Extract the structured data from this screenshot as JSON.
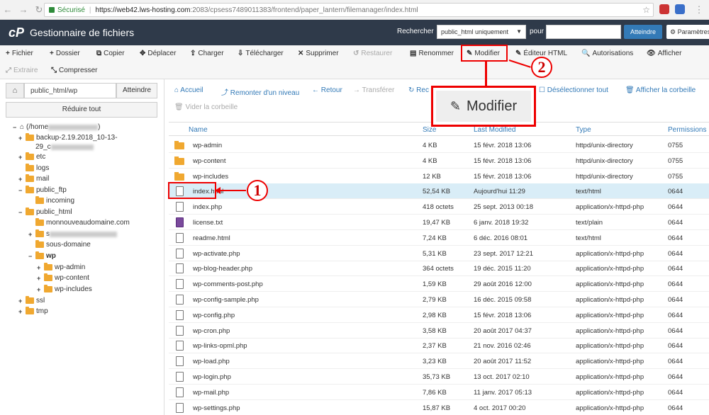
{
  "browser": {
    "secure_label": "Sécurisé",
    "url_host": "https://web42.lws-hosting.com",
    "url_path": ":2083/cpsess7489011383/frontend/paper_lantern/filemanager/index.html"
  },
  "header": {
    "logo": "cP",
    "title": "Gestionnaire de fichiers",
    "search_label": "Rechercher",
    "search_scope": "public_html uniquement",
    "pour_label": "pour",
    "go_label": "Atteindre",
    "settings_label": "Paramètres"
  },
  "toolbar": {
    "row1": [
      {
        "icon": "+",
        "label": "Fichier",
        "name": "new-file"
      },
      {
        "icon": "+",
        "label": "Dossier",
        "name": "new-folder"
      },
      {
        "icon": "⧉",
        "label": "Copier",
        "name": "copy"
      },
      {
        "icon": "✥",
        "label": "Déplacer",
        "name": "move"
      },
      {
        "icon": "⇪",
        "label": "Charger",
        "name": "upload"
      },
      {
        "icon": "⇩",
        "label": "Télécharger",
        "name": "download"
      },
      {
        "icon": "✕",
        "label": "Supprimer",
        "name": "delete"
      },
      {
        "icon": "↺",
        "label": "Restaurer",
        "name": "restore"
      },
      {
        "icon": "▤",
        "label": "Renommer",
        "name": "rename"
      },
      {
        "icon": "✎",
        "label": "Modifier",
        "name": "edit"
      },
      {
        "icon": "✎",
        "label": "Éditeur HTML",
        "name": "html-editor"
      },
      {
        "icon": "🔍",
        "label": "Autorisations",
        "name": "permissions"
      },
      {
        "icon": "👁",
        "label": "Afficher",
        "name": "view"
      }
    ],
    "row2": [
      {
        "icon": "⤢",
        "label": "Extraire",
        "name": "extract"
      },
      {
        "icon": "⤡",
        "label": "Compresser",
        "name": "compress"
      }
    ]
  },
  "left": {
    "path_value": "public_html/wp",
    "go_label": "Atteindre",
    "collapse_label": "Réduire tout",
    "tree": [
      {
        "label": "(/home",
        "tog": "−",
        "home": true
      },
      {
        "label": "backup-2.19.2018_10-13-",
        "tog": "+"
      },
      {
        "label": "29_c",
        "tog": ""
      },
      {
        "label": "etc",
        "tog": "+"
      },
      {
        "label": "logs",
        "tog": ""
      },
      {
        "label": "mail",
        "tog": "+"
      },
      {
        "label": "public_ftp",
        "tog": "−"
      },
      {
        "label": "incoming",
        "tog": ""
      },
      {
        "label": "public_html",
        "tog": "−"
      },
      {
        "label": "monnouveaudomaine.com",
        "tog": ""
      },
      {
        "label": "s",
        "tog": "+"
      },
      {
        "label": "sous-domaine",
        "tog": ""
      },
      {
        "label": "wp",
        "tog": "−"
      },
      {
        "label": "wp-admin",
        "tog": "+"
      },
      {
        "label": "wp-content",
        "tog": "+"
      },
      {
        "label": "wp-includes",
        "tog": "+"
      },
      {
        "label": "ssl",
        "tog": "+"
      },
      {
        "label": "tmp",
        "tog": "+"
      }
    ]
  },
  "actions": {
    "home": "Accueil",
    "up": "Remonter d'un niveau",
    "back": "Retour",
    "forward": "Transférer",
    "reload": "Rec",
    "deselect": "Désélectionner tout",
    "trash": "Afficher la corbeille",
    "empty_trash": "Vider la corbeille"
  },
  "table": {
    "headers": {
      "name": "Name",
      "size": "Size",
      "modified": "Last Modified",
      "type": "Type",
      "perms": "Permissions"
    },
    "rows": [
      {
        "name": "wp-admin",
        "size": "4 KB",
        "date": "15 févr. 2018 13:06",
        "type": "httpd/unix-directory",
        "perms": "0755",
        "kind": "folder"
      },
      {
        "name": "wp-content",
        "size": "4 KB",
        "date": "15 févr. 2018 13:06",
        "type": "httpd/unix-directory",
        "perms": "0755",
        "kind": "folder"
      },
      {
        "name": "wp-includes",
        "size": "12 KB",
        "date": "15 févr. 2018 13:06",
        "type": "httpd/unix-directory",
        "perms": "0755",
        "kind": "folder"
      },
      {
        "name": "index.html",
        "size": "52,54 KB",
        "date": "Aujourd'hui 11:29",
        "type": "text/html",
        "perms": "0644",
        "kind": "file"
      },
      {
        "name": "index.php",
        "size": "418 octets",
        "date": "25 sept. 2013 00:18",
        "type": "application/x-httpd-php",
        "perms": "0644",
        "kind": "file"
      },
      {
        "name": "license.txt",
        "size": "19,47 KB",
        "date": "6 janv. 2018 19:32",
        "type": "text/plain",
        "perms": "0644",
        "kind": "txt"
      },
      {
        "name": "readme.html",
        "size": "7,24 KB",
        "date": "6 déc. 2016 08:01",
        "type": "text/html",
        "perms": "0644",
        "kind": "file"
      },
      {
        "name": "wp-activate.php",
        "size": "5,31 KB",
        "date": "23 sept. 2017 12:21",
        "type": "application/x-httpd-php",
        "perms": "0644",
        "kind": "file"
      },
      {
        "name": "wp-blog-header.php",
        "size": "364 octets",
        "date": "19 déc. 2015 11:20",
        "type": "application/x-httpd-php",
        "perms": "0644",
        "kind": "file"
      },
      {
        "name": "wp-comments-post.php",
        "size": "1,59 KB",
        "date": "29 août 2016 12:00",
        "type": "application/x-httpd-php",
        "perms": "0644",
        "kind": "file"
      },
      {
        "name": "wp-config-sample.php",
        "size": "2,79 KB",
        "date": "16 déc. 2015 09:58",
        "type": "application/x-httpd-php",
        "perms": "0644",
        "kind": "file"
      },
      {
        "name": "wp-config.php",
        "size": "2,98 KB",
        "date": "15 févr. 2018 13:06",
        "type": "application/x-httpd-php",
        "perms": "0644",
        "kind": "file"
      },
      {
        "name": "wp-cron.php",
        "size": "3,58 KB",
        "date": "20 août 2017 04:37",
        "type": "application/x-httpd-php",
        "perms": "0644",
        "kind": "file"
      },
      {
        "name": "wp-links-opml.php",
        "size": "2,37 KB",
        "date": "21 nov. 2016 02:46",
        "type": "application/x-httpd-php",
        "perms": "0644",
        "kind": "file"
      },
      {
        "name": "wp-load.php",
        "size": "3,23 KB",
        "date": "20 août 2017 11:52",
        "type": "application/x-httpd-php",
        "perms": "0644",
        "kind": "file"
      },
      {
        "name": "wp-login.php",
        "size": "35,73 KB",
        "date": "13 oct. 2017 02:10",
        "type": "application/x-httpd-php",
        "perms": "0644",
        "kind": "file"
      },
      {
        "name": "wp-mail.php",
        "size": "7,86 KB",
        "date": "11 janv. 2017 05:13",
        "type": "application/x-httpd-php",
        "perms": "0644",
        "kind": "file"
      },
      {
        "name": "wp-settings.php",
        "size": "15,87 KB",
        "date": "4 oct. 2017 00:20",
        "type": "application/x-httpd-php",
        "perms": "0644",
        "kind": "file"
      }
    ]
  },
  "annotations": {
    "callout_label": "Modifier",
    "step1": "1",
    "step2": "2"
  }
}
